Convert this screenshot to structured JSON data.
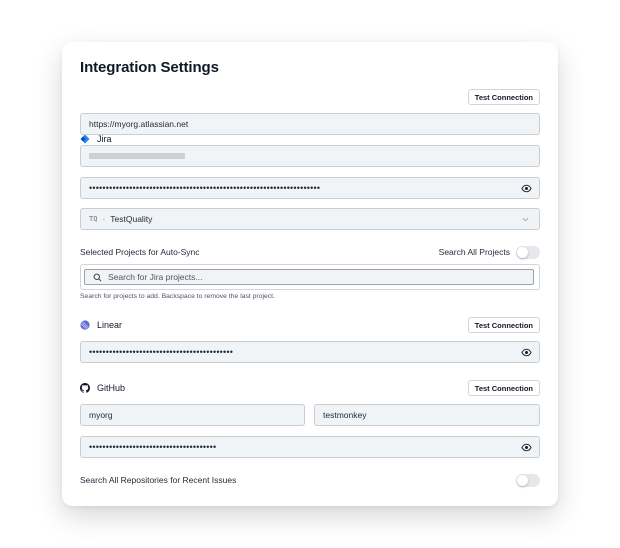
{
  "title": "Integration Settings",
  "jira": {
    "name": "Jira",
    "test_button": "Test Connection",
    "url_value": "https://myorg.atlassian.net",
    "token_dots": "•••••••••••••••••••••••••••••••••••••••••••••••••••••••••••••••••••••",
    "project_select": {
      "key": "TQ",
      "separator": "·",
      "name": "TestQuality"
    },
    "auto_sync_label": "Selected Projects for Auto-Sync",
    "search_all_label": "Search All Projects",
    "search_all_enabled": false,
    "search_placeholder": "Search for Jira projects...",
    "search_hint": "Search for projects to add. Backspace to remove the last project."
  },
  "linear": {
    "name": "Linear",
    "test_button": "Test Connection",
    "token_dots": "•••••••••••••••••••••••••••••••••••••••••••"
  },
  "github": {
    "name": "GitHub",
    "test_button": "Test Connection",
    "owner_value": "myorg",
    "repo_value": "testmonkey",
    "token_dots": "••••••••••••••••••••••••••••••••••••••",
    "search_repos_label": "Search All Repositories for Recent Issues",
    "search_repos_enabled": false
  },
  "colors": {
    "jira_blue": "#2684ff",
    "linear_purple": "#5e6ad2",
    "field_bg": "#f1f4f6",
    "field_border": "#c9ced4"
  }
}
